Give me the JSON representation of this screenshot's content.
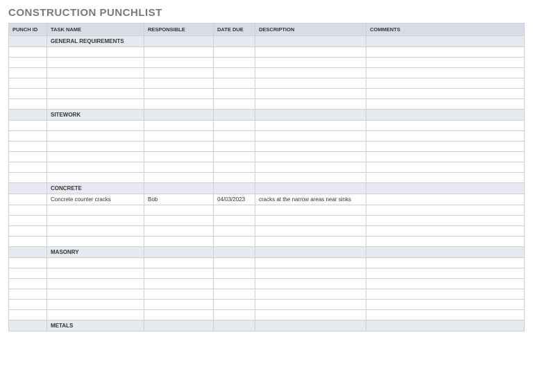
{
  "title": "CONSTRUCTION PUNCHLIST",
  "columns": {
    "punch_id": "PUNCH ID",
    "task_name": "TASK NAME",
    "responsible": "RESPONSIBLE",
    "date_due": "DATE DUE",
    "description": "DESCRIPTION",
    "comments": "COMMENTS"
  },
  "sections": [
    {
      "name": "GENERAL REQUIREMENTS",
      "rows": [
        {
          "punch_id": "",
          "task_name": "",
          "responsible": "",
          "date_due": "",
          "description": "",
          "comments": ""
        },
        {
          "punch_id": "",
          "task_name": "",
          "responsible": "",
          "date_due": "",
          "description": "",
          "comments": ""
        },
        {
          "punch_id": "",
          "task_name": "",
          "responsible": "",
          "date_due": "",
          "description": "",
          "comments": ""
        },
        {
          "punch_id": "",
          "task_name": "",
          "responsible": "",
          "date_due": "",
          "description": "",
          "comments": ""
        },
        {
          "punch_id": "",
          "task_name": "",
          "responsible": "",
          "date_due": "",
          "description": "",
          "comments": ""
        },
        {
          "punch_id": "",
          "task_name": "",
          "responsible": "",
          "date_due": "",
          "description": "",
          "comments": ""
        }
      ]
    },
    {
      "name": "SITEWORK",
      "rows": [
        {
          "punch_id": "",
          "task_name": "",
          "responsible": "",
          "date_due": "",
          "description": "",
          "comments": ""
        },
        {
          "punch_id": "",
          "task_name": "",
          "responsible": "",
          "date_due": "",
          "description": "",
          "comments": ""
        },
        {
          "punch_id": "",
          "task_name": "",
          "responsible": "",
          "date_due": "",
          "description": "",
          "comments": ""
        },
        {
          "punch_id": "",
          "task_name": "",
          "responsible": "",
          "date_due": "",
          "description": "",
          "comments": ""
        },
        {
          "punch_id": "",
          "task_name": "",
          "responsible": "",
          "date_due": "",
          "description": "",
          "comments": ""
        },
        {
          "punch_id": "",
          "task_name": "",
          "responsible": "",
          "date_due": "",
          "description": "",
          "comments": ""
        }
      ]
    },
    {
      "name": "CONCRETE",
      "rows": [
        {
          "punch_id": "",
          "task_name": "Concrete counter cracks",
          "responsible": "Bob",
          "date_due": "04/03/2023",
          "description": "cracks at the narrow areas near sinks",
          "comments": ""
        },
        {
          "punch_id": "",
          "task_name": "",
          "responsible": "",
          "date_due": "",
          "description": "",
          "comments": ""
        },
        {
          "punch_id": "",
          "task_name": "",
          "responsible": "",
          "date_due": "",
          "description": "",
          "comments": ""
        },
        {
          "punch_id": "",
          "task_name": "",
          "responsible": "",
          "date_due": "",
          "description": "",
          "comments": ""
        },
        {
          "punch_id": "",
          "task_name": "",
          "responsible": "",
          "date_due": "",
          "description": "",
          "comments": ""
        }
      ]
    },
    {
      "name": "MASONRY",
      "rows": [
        {
          "punch_id": "",
          "task_name": "",
          "responsible": "",
          "date_due": "",
          "description": "",
          "comments": ""
        },
        {
          "punch_id": "",
          "task_name": "",
          "responsible": "",
          "date_due": "",
          "description": "",
          "comments": ""
        },
        {
          "punch_id": "",
          "task_name": "",
          "responsible": "",
          "date_due": "",
          "description": "",
          "comments": ""
        },
        {
          "punch_id": "",
          "task_name": "",
          "responsible": "",
          "date_due": "",
          "description": "",
          "comments": ""
        },
        {
          "punch_id": "",
          "task_name": "",
          "responsible": "",
          "date_due": "",
          "description": "",
          "comments": ""
        },
        {
          "punch_id": "",
          "task_name": "",
          "responsible": "",
          "date_due": "",
          "description": "",
          "comments": ""
        }
      ]
    },
    {
      "name": "METALS",
      "rows": []
    }
  ]
}
